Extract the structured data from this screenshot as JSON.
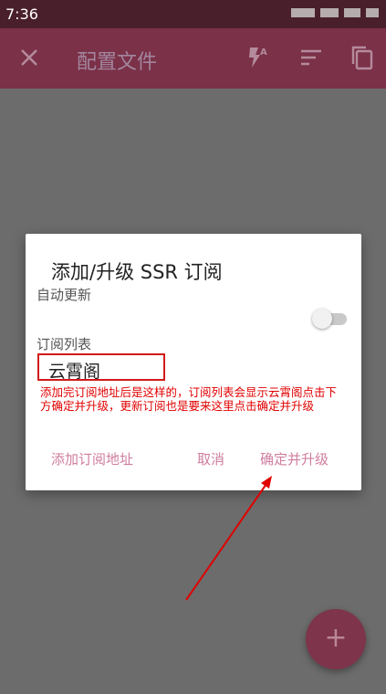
{
  "status_bar": {
    "time": "7:36"
  },
  "toolbar": {
    "title": "配置文件"
  },
  "dialog": {
    "title": "添加/升级 SSR 订阅",
    "auto_update_label": "自动更新",
    "auto_update_enabled": false,
    "subscription_list_label": "订阅列表",
    "subscription_items": [
      "云霄阁"
    ],
    "annotation": "添加完订阅地址后是这样的，订阅列表会显示云霄阁点击下方确定并升级，更新订阅也是要来这里点击确定并升级",
    "buttons": {
      "add_url": "添加订阅地址",
      "cancel": "取消",
      "confirm": "确定并升级"
    }
  },
  "fab": {
    "icon": "plus-icon",
    "label": "+"
  },
  "colors": {
    "toolbar": "#7b3148",
    "status_bar": "#4a1f2c",
    "accent": "#cf7d9e",
    "annotation": "#e00000"
  }
}
